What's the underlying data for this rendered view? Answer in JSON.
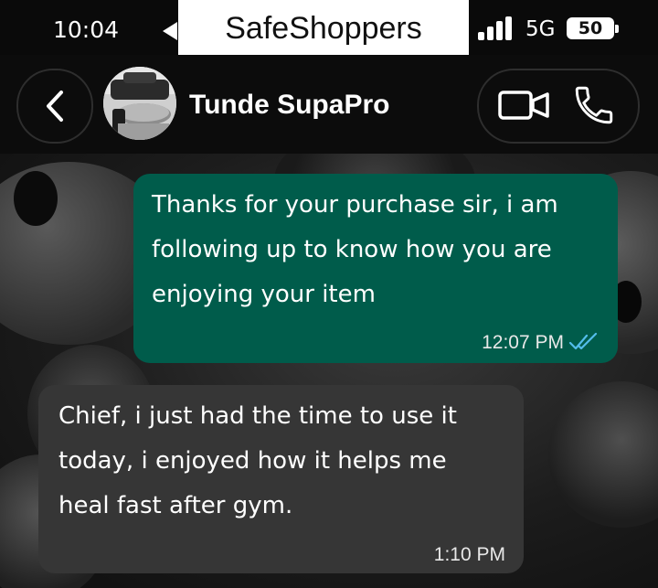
{
  "status_bar": {
    "time": "10:04",
    "network": "5G",
    "battery": "50"
  },
  "overlay_label": "SafeShoppers",
  "header": {
    "contact_name": "Tunde SupaPro"
  },
  "messages": [
    {
      "direction": "outgoing",
      "lines": [
        "Thanks for your purchase sir, i am",
        "following up to know how you are",
        "enjoying your item"
      ],
      "time": "12:07 PM",
      "status": "read"
    },
    {
      "direction": "incoming",
      "lines": [
        "Chief, i just had the time to use it",
        "today, i enjoyed how it helps me",
        "heal fast after gym."
      ],
      "time": "1:10 PM"
    }
  ],
  "colors": {
    "outgoing_bubble": "#005c4b",
    "incoming_bubble": "#363636",
    "read_ticks": "#53bdeb"
  }
}
